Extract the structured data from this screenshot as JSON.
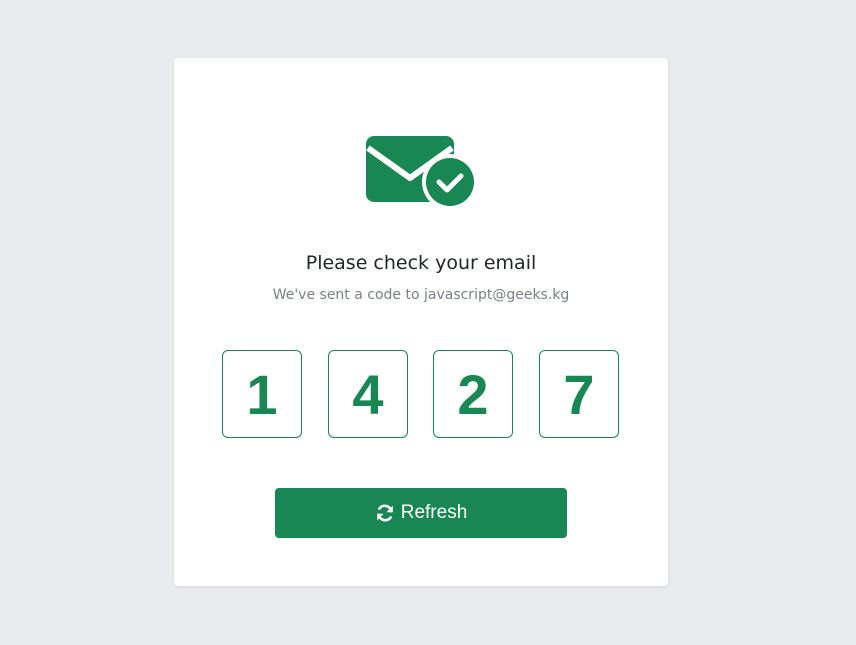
{
  "header": {
    "title": "Please check your email",
    "subtitle": "We've sent a code to javascript@geeks.kg"
  },
  "code": {
    "digits": [
      "1",
      "4",
      "2",
      "7"
    ]
  },
  "actions": {
    "refresh_label": "Refresh"
  },
  "icons": {
    "hero": "email-check-icon",
    "refresh": "refresh-icon"
  },
  "colors": {
    "accent": "#198754",
    "background": "#e9ebee",
    "card": "#ffffff",
    "title": "#212529",
    "subtitle": "#7a7f85"
  }
}
